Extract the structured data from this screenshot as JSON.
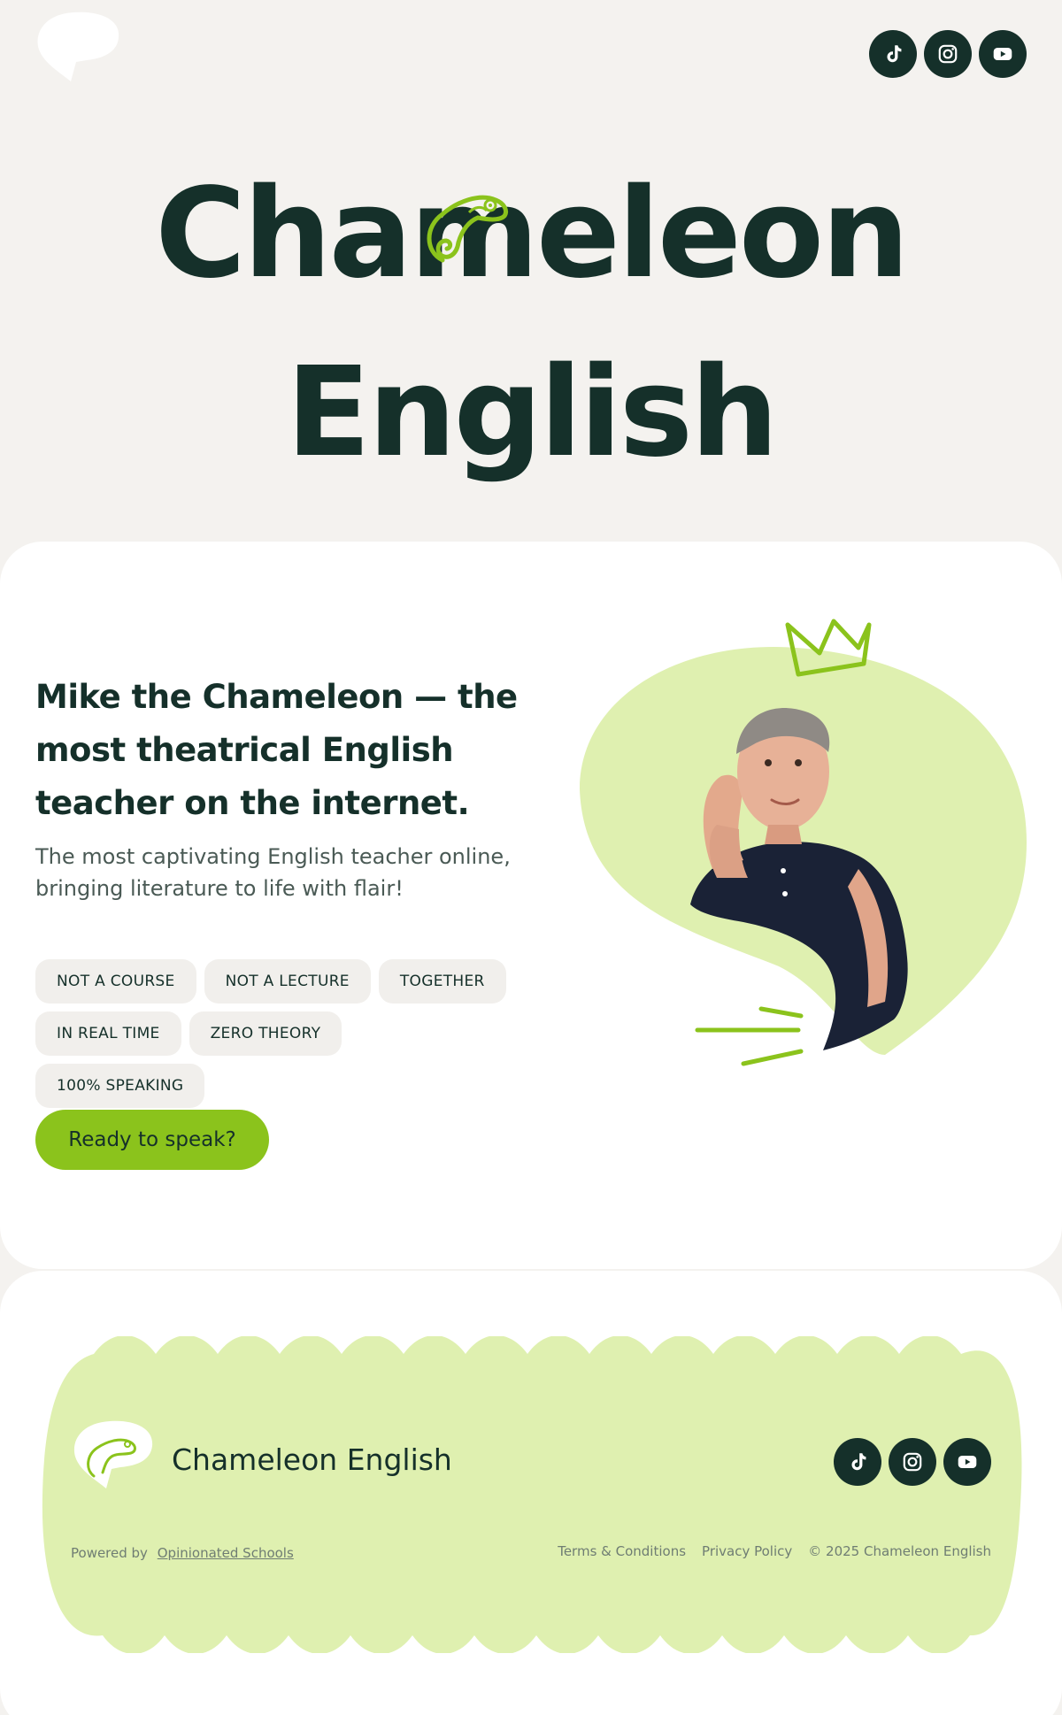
{
  "header": {
    "logo_icon": "speech-bubble-logo",
    "social": [
      {
        "name": "tiktok-icon"
      },
      {
        "name": "instagram-icon"
      },
      {
        "name": "youtube-icon"
      }
    ]
  },
  "hero": {
    "title_line1": "Chameleon",
    "title_line2": "English"
  },
  "intro": {
    "heading": "Mike the Chameleon — the most theatrical English teacher on the internet.",
    "subtitle": "The most captivating English teacher online, bringing literature to life with flair!",
    "tags": [
      "NOT A COURSE",
      "NOT A LECTURE",
      "TOGETHER",
      "IN REAL TIME",
      "ZERO THEORY",
      "100% SPEAKING"
    ],
    "cta_label": "Ready to speak?"
  },
  "footer": {
    "brand": "Chameleon English",
    "powered_by": "Powered by",
    "powered_link": "Opinionated Schools",
    "links": [
      "Terms & Conditions",
      "Privacy Policy",
      "© 2025 Chameleon English"
    ]
  },
  "colors": {
    "accent": "#8bc31c",
    "dark": "#15302a",
    "pale_green": "#dff0b0",
    "background": "#f4f2ef"
  }
}
